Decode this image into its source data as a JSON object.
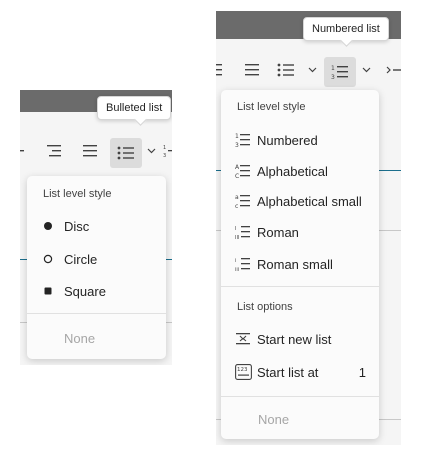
{
  "bulleted_panel": {
    "tooltip": "Bulleted list",
    "menu": {
      "section_title": "List level style",
      "items": [
        {
          "label": "Disc",
          "icon": "disc-bullet-icon"
        },
        {
          "label": "Circle",
          "icon": "circle-bullet-icon"
        },
        {
          "label": "Square",
          "icon": "square-bullet-icon"
        }
      ],
      "none_label": "None"
    }
  },
  "numbered_panel": {
    "tooltip": "Numbered list",
    "menu": {
      "section_title": "List level style",
      "styles": [
        {
          "label": "Numbered",
          "icon": "numbered-list-icon"
        },
        {
          "label": "Alphabetical",
          "icon": "alphabetical-list-icon"
        },
        {
          "label": "Alphabetical small",
          "icon": "alphabetical-small-list-icon"
        },
        {
          "label": "Roman",
          "icon": "roman-list-icon"
        },
        {
          "label": "Roman small",
          "icon": "roman-small-list-icon"
        }
      ],
      "options_title": "List options",
      "options": [
        {
          "label": "Start new list",
          "icon": "start-new-list-icon"
        },
        {
          "label": "Start list at",
          "icon": "start-list-at-icon",
          "value": "1"
        }
      ],
      "none_label": "None"
    }
  },
  "colors": {
    "accent_line": "#1b6e8c",
    "topbar": "#6b6b6b",
    "toolbar": "#f5f5f5",
    "active_button": "#dcdcdc",
    "disabled_text": "#a6a6a6"
  }
}
